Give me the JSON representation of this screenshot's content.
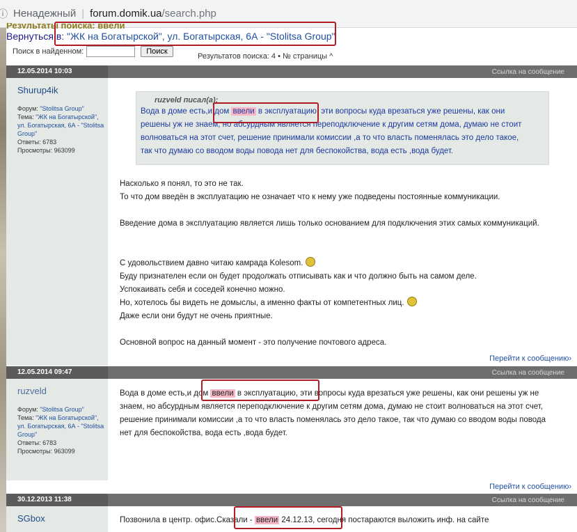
{
  "browser": {
    "security_label": "Ненадежный",
    "url_host": "forum.domik.ua",
    "url_path": "/search.php"
  },
  "header": {
    "cut_heading": "Результаты поиска: ввели",
    "back_prefix": "Вернуться в: ",
    "back_link": "\"ЖК на Богатырской\", ул. Богатырская, 6А - \"Stolitsa Group\"",
    "search_label": "Поиск в найденном:",
    "search_value": "",
    "search_button": "Поиск",
    "results_text": "Результатов поиска: 4 • № страницы ^"
  },
  "posts": [
    {
      "date": "12.05.2014 10:03",
      "permalink": "Ссылка на сообщение",
      "author": "Shurup4ik",
      "forum_label": "Форум:",
      "forum_value": "\"Stolitsa Group\"",
      "topic_label": "Тема:",
      "topic_value": "\"ЖК на Богатырской\", ул. Богатырская, 6А - \"Stolitsa Group\"",
      "replies_label": "Ответы:",
      "replies_value": "6783",
      "views_label": "Просмотры:",
      "views_value": "963099",
      "quote_author": "ruzveld писал(а):",
      "quote_lines": [
        {
          "pre": "Вода в доме есть,и дом ",
          "hl": "ввели",
          "post": " в эксплуатацию, эти вопросы куда врезаться уже решены, как они"
        },
        {
          "text": "решены уж не знаем, но абсурдным является переподключение к другим сетям дома, думаю не стоит"
        },
        {
          "text": "волноваться на этот счет, решение принимали комиссии ,а то что власть поменялась это дело такое,"
        },
        {
          "text": "так что думаю со вводом воды повода нет для беспокойства, вода есть ,вода будет."
        }
      ],
      "body_lines": [
        "Насколько я понял, то это не так.",
        "То что дом введён в эксплуатацию не означает что к нему уже подведены постоянные коммуникации.",
        "",
        "Введение дома в эксплуатацию является лишь только основанием для подключения этих самых коммуникаций.",
        "",
        "",
        "С удовольствием давно читаю камрада Kolesom.",
        "Буду признателен если он будет продолжать отписывать как и что должно быть на самом деле.",
        "Успокаивать себя и соседей конечно можно.",
        "Но, хотелось бы видеть не домыслы, а именно факты от компетентных лиц.",
        "Даже если они будут не очень приятные.",
        "",
        "Основной вопрос на данный момент - это получение почтового адреса."
      ],
      "goto": "Перейти к сообщению›"
    },
    {
      "date": "12.05.2014 09:47",
      "permalink": "Ссылка на сообщение",
      "author": "ruzveld",
      "forum_label": "Форум:",
      "forum_value": "\"Stolitsa Group\"",
      "topic_label": "Тема:",
      "topic_value": "\"ЖК на Богатырской\", ул. Богатырская, 6А - \"Stolitsa Group\"",
      "replies_label": "Ответы:",
      "replies_value": "6783",
      "views_label": "Просмотры:",
      "views_value": "963099",
      "body_lines": [
        {
          "pre": "Вода в доме есть,и дом ",
          "hl": "ввели",
          "post": " в эксплуатацию, эти вопросы куда врезаться уже решены, как они решены уж не"
        },
        {
          "text": "знаем, но абсурдным является переподключение к другим сетям дома, думаю не стоит волноваться на этот счет,"
        },
        {
          "text": "решение принимали комиссии ,а то что власть поменялась это дело такое, так что думаю со вводом воды повода"
        },
        {
          "text": "нет для беспокойства, вода есть ,вода будет."
        }
      ],
      "goto": "Перейти к сообщению›"
    },
    {
      "date": "30.12.2013 11:38",
      "permalink": "Ссылка на сообщение",
      "author": "SGbox",
      "body_pre": "Позвонила в центр. офис.Сказали - ",
      "body_hl": "ввели",
      "body_post": " 24.12.13, сегодня постараются выложить инф. на сайте"
    }
  ]
}
